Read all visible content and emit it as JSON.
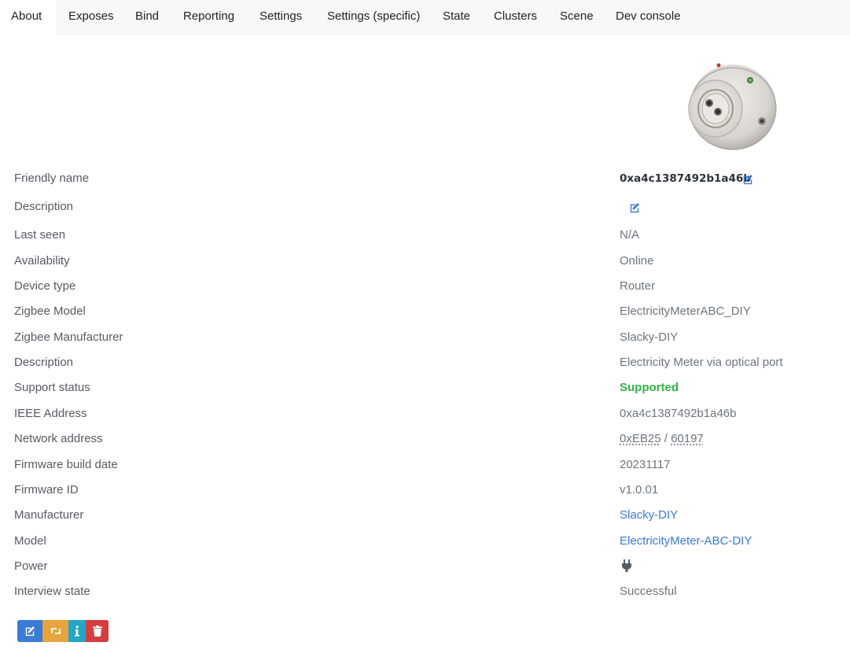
{
  "tabs": [
    {
      "label": "About",
      "active": true
    },
    {
      "label": "Exposes"
    },
    {
      "label": "Bind"
    },
    {
      "label": "Reporting"
    },
    {
      "label": "Settings"
    },
    {
      "label": "Settings (specific)"
    },
    {
      "label": "State"
    },
    {
      "label": "Clusters"
    },
    {
      "label": "Scene"
    },
    {
      "label": "Dev console"
    }
  ],
  "device_image": {
    "name": "electricity-meter-optical-reader"
  },
  "rows": {
    "friendly_name": {
      "label": "Friendly name",
      "value": "0xa4c1387492b1a46b"
    },
    "description_edit": {
      "label": "Description",
      "value": ""
    },
    "last_seen": {
      "label": "Last seen",
      "value": "N/A"
    },
    "availability": {
      "label": "Availability",
      "value": "Online"
    },
    "device_type": {
      "label": "Device type",
      "value": "Router"
    },
    "zigbee_model": {
      "label": "Zigbee Model",
      "value": "ElectricityMeterABC_DIY"
    },
    "zigbee_manufacturer": {
      "label": "Zigbee Manufacturer",
      "value": "Slacky-DIY"
    },
    "description": {
      "label": "Description",
      "value": "Electricity Meter via optical port"
    },
    "support_status": {
      "label": "Support status",
      "value": "Supported"
    },
    "ieee_address": {
      "label": "IEEE Address",
      "value": "0xa4c1387492b1a46b"
    },
    "network_address": {
      "label": "Network address",
      "hex": "0xEB25",
      "separator": " / ",
      "dec": "60197"
    },
    "firmware_build_date": {
      "label": "Firmware build date",
      "value": "20231117"
    },
    "firmware_id": {
      "label": "Firmware ID",
      "value": "v1.0.01"
    },
    "manufacturer": {
      "label": "Manufacturer",
      "value": "Slacky-DIY"
    },
    "model": {
      "label": "Model",
      "value": "ElectricityMeter-ABC-DIY"
    },
    "power": {
      "label": "Power",
      "icon": "plug-icon"
    },
    "interview_state": {
      "label": "Interview state",
      "value": "Successful"
    }
  },
  "actions": [
    {
      "name": "rename",
      "icon": "edit-icon",
      "color": "#3a7bd5"
    },
    {
      "name": "reconfigure",
      "icon": "retweet-icon",
      "color": "#e7a33e"
    },
    {
      "name": "interview",
      "icon": "info-icon",
      "color": "#25a6c9"
    },
    {
      "name": "remove",
      "icon": "trash-icon",
      "color": "#d63d3d"
    }
  ],
  "colors": {
    "link": "#3a7bd5",
    "supported": "#2fb344",
    "label": "#555b62",
    "value": "#6c757d"
  }
}
